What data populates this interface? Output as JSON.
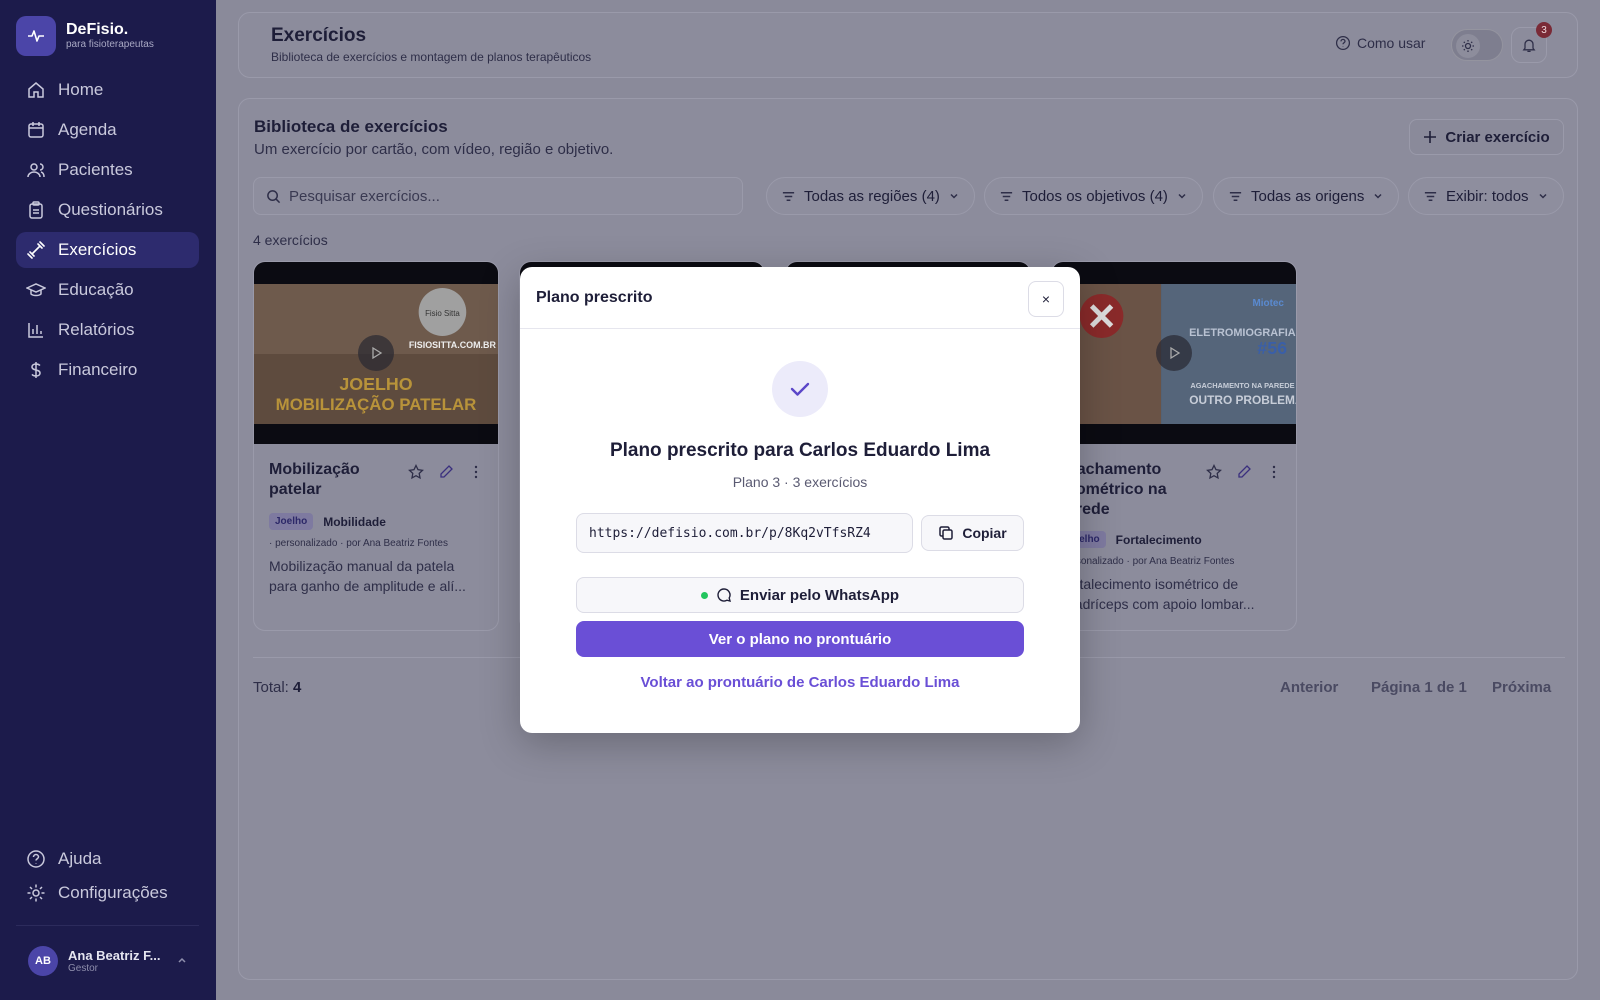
{
  "sidebar": {
    "brand_name": "DeFisio.",
    "brand_tagline": "para fisioterapeutas",
    "items": [
      {
        "label": "Home",
        "icon": "home-icon"
      },
      {
        "label": "Agenda",
        "icon": "calendar-icon"
      },
      {
        "label": "Pacientes",
        "icon": "users-icon"
      },
      {
        "label": "Questionários",
        "icon": "clipboard-icon"
      },
      {
        "label": "Exercícios",
        "icon": "dumbbell-icon",
        "active": true
      },
      {
        "label": "Educação",
        "icon": "graduation-cap-icon"
      },
      {
        "label": "Relatórios",
        "icon": "bar-chart-icon"
      },
      {
        "label": "Financeiro",
        "icon": "dollar-icon"
      }
    ],
    "bottom_items": [
      {
        "label": "Ajuda",
        "icon": "help-circle-icon"
      },
      {
        "label": "Configurações",
        "icon": "gear-icon"
      }
    ],
    "user": {
      "initials": "AB",
      "name": "Ana Beatriz F...",
      "role": "Gestor"
    }
  },
  "header": {
    "title": "Exercícios",
    "subtitle": "Biblioteca de exercícios e montagem de planos terapêuticos",
    "how_to_label": "Como usar",
    "notification_count": "3"
  },
  "library": {
    "title": "Biblioteca de exercícios",
    "subtitle": "Um exercício por cartão, com vídeo, região e objetivo.",
    "create_label": "Criar exercício",
    "search_placeholder": "Pesquisar exercícios...",
    "filters": [
      "Todas as regiões (4)",
      "Todos os objetivos (4)",
      "Todas as origens",
      "Exibir: todos"
    ],
    "count_label": "4 exercícios",
    "cards": [
      {
        "title": "Mobilização patelar",
        "region": "Joelho",
        "objective": "Mobilidade",
        "meta": "· personalizado · por Ana Beatriz Fontes",
        "description": "Mobilização manual da patela para ganho de amplitude e alí...",
        "thumb_text_1": "JOELHO",
        "thumb_text_2": "MOBILIZAÇÃO PATELAR",
        "thumb_text_3": "FISIOSITTA.COM.BR",
        "thumb_text_4": "Fisio Sitta"
      },
      {
        "title": "Agachamento isométrico na parede",
        "title_visible": "gachamento\nsométrico na\narede",
        "region": "Joelho",
        "region_visible": "oelho",
        "objective": "Fortalecimento",
        "meta": "ersonalizado · por Ana Beatriz Fontes",
        "description": "ortalecimento isométrico de uadríceps com apoio lombar...",
        "thumb_text_1": "ELETROMIOGRAFIA",
        "thumb_text_2": "#56",
        "thumb_text_3": "AGACHAMENTO NA PAREDE",
        "thumb_text_4": "OUTRO PROBLEMA",
        "thumb_text_5": "Miotec"
      }
    ],
    "total_label": "Total:",
    "total_value": "4",
    "prev_label": "Anterior",
    "page_label": "Página 1 de 1",
    "next_label": "Próxima"
  },
  "modal": {
    "title": "Plano prescrito",
    "close_glyph": "×",
    "success_title": "Plano prescrito para Carlos Eduardo Lima",
    "success_sub": "Plano 3 · 3 exercícios",
    "link": "https://defisio.com.br/p/8Kq2vTfsRZ4",
    "copy_label": "Copiar",
    "whatsapp_label": "Enviar pelo WhatsApp",
    "primary_label": "Ver o plano no prontuário",
    "back_label": "Voltar ao prontuário de Carlos Eduardo Lima"
  },
  "colors": {
    "sidebar_bg": "#1c1b4b",
    "accent": "#6a4fd6",
    "overlay": "#8a8a9a",
    "success_dot": "#22c55e"
  }
}
